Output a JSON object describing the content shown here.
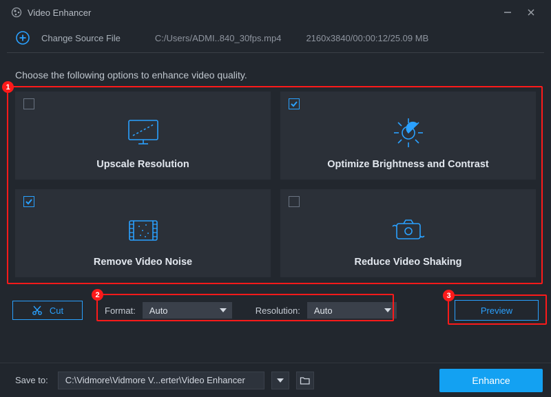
{
  "app": {
    "title": "Video Enhancer"
  },
  "header": {
    "change_source": "Change Source File",
    "file_path": "C:/Users/ADMI..840_30fps.mp4",
    "file_info": "2160x3840/00:00:12/25.09 MB"
  },
  "instruction": "Choose the following options to enhance video quality.",
  "options": {
    "upscale": {
      "label": "Upscale Resolution",
      "checked": false
    },
    "brightness": {
      "label": "Optimize Brightness and Contrast",
      "checked": true
    },
    "noise": {
      "label": "Remove Video Noise",
      "checked": true
    },
    "shaking": {
      "label": "Reduce Video Shaking",
      "checked": false
    }
  },
  "controls": {
    "cut_label": "Cut",
    "format_label": "Format:",
    "format_value": "Auto",
    "resolution_label": "Resolution:",
    "resolution_value": "Auto",
    "preview_label": "Preview"
  },
  "callouts": {
    "c1": "1",
    "c2": "2",
    "c3": "3"
  },
  "footer": {
    "save_label": "Save to:",
    "save_path": "C:\\Vidmore\\Vidmore V...erter\\Video Enhancer",
    "enhance_label": "Enhance"
  }
}
